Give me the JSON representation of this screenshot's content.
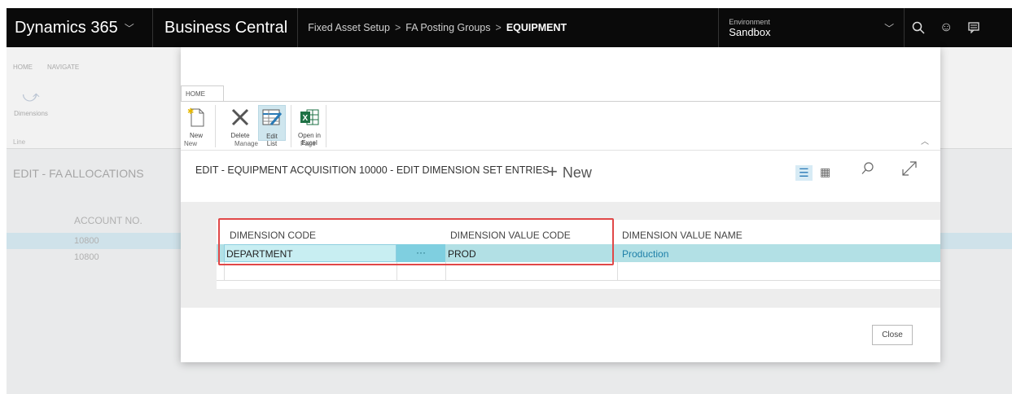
{
  "topbar": {
    "product": "Dynamics 365",
    "app": "Business Central",
    "breadcrumb": [
      "Fixed Asset Setup",
      "FA Posting Groups",
      "EQUIPMENT"
    ],
    "environment_label": "Environment",
    "environment_value": "Sandbox"
  },
  "background": {
    "tabs": [
      "HOME",
      "NAVIGATE"
    ],
    "dimensions_label": "Dimensions",
    "line_group": "Line",
    "title": "EDIT - FA ALLOCATIONS",
    "column_header": "ACCOUNT NO.",
    "rows": [
      "10800",
      "10800"
    ]
  },
  "dialog": {
    "ribbon_tab": "HOME",
    "buttons": {
      "new": "New",
      "delete": "Delete",
      "edit_list_1": "Edit",
      "edit_list_2": "List",
      "open_excel_1": "Open in",
      "open_excel_2": "Excel"
    },
    "groups": {
      "new": "New",
      "manage": "Manage",
      "page": "Page"
    },
    "title": "EDIT - EQUIPMENT ACQUISITION 10000 - EDIT DIMENSION SET ENTRIES",
    "new_action": "New",
    "columns": {
      "dimension_code": "DIMENSION CODE",
      "dimension_value_code": "DIMENSION VALUE CODE",
      "dimension_value_name": "DIMENSION VALUE NAME"
    },
    "row": {
      "dimension_code": "DEPARTMENT",
      "lookup": "···",
      "dimension_value_code": "PROD",
      "dimension_value_name": "Production"
    },
    "close_button": "Close"
  },
  "colors": {
    "topbar": "#0a0a0a",
    "selected_row": "#b2e0e5",
    "highlight_box": "#e04848",
    "link": "#1e7fa8"
  }
}
